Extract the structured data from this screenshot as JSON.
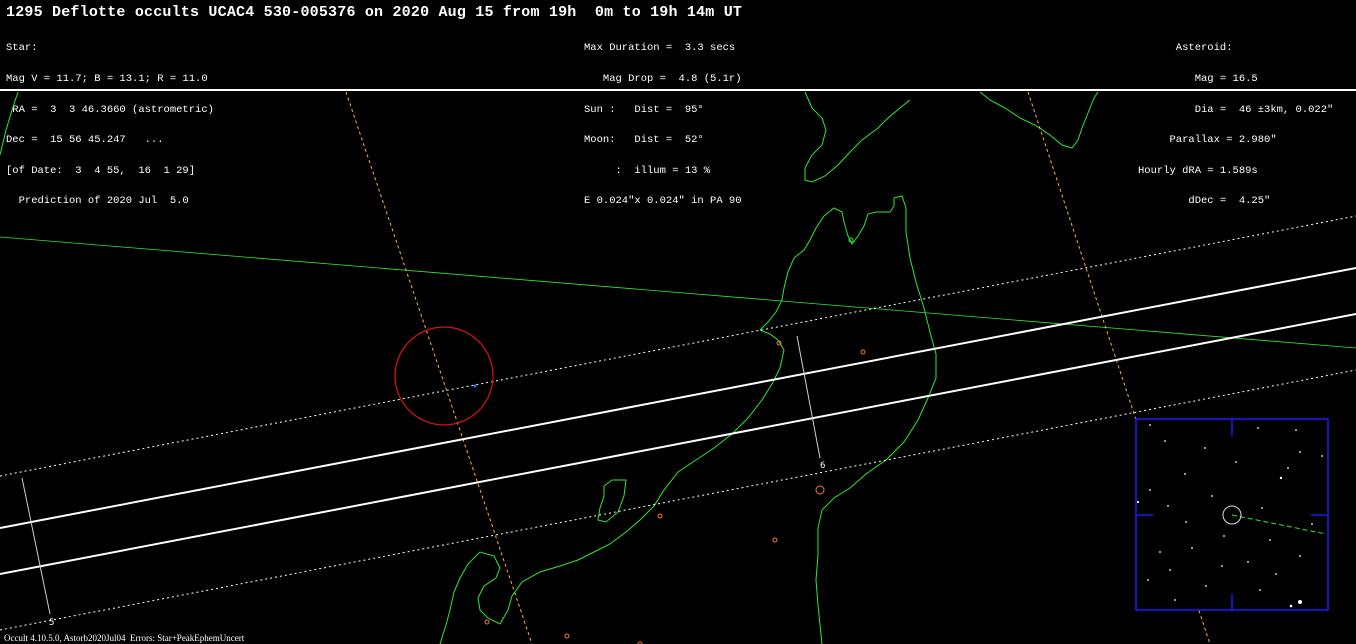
{
  "header": {
    "title": "1295 Deflotte occults UCAC4 530-005376 on 2020 Aug 15 from 19h  0m to 19h 14m UT",
    "star_lines": [
      "Star:",
      "Mag V = 11.7; B = 13.1; R = 11.0",
      " RA =  3  3 46.3660 (astrometric)",
      "Dec =  15 56 45.247   ...",
      "[of Date:  3  4 55,  16  1 29]",
      "  Prediction of 2020 Jul  5.0"
    ],
    "event_lines": [
      "Max Duration =  3.3 secs",
      "   Mag Drop =  4.8 (5.1r)",
      "Sun :   Dist =  95°",
      "Moon:   Dist =  52°",
      "     :  illum = 13 %",
      "E 0.024\"x 0.024\" in PA 90"
    ],
    "asteroid_lines": [
      "      Asteroid:",
      "         Mag = 16.5",
      "         Dia =  46 ±3km, 0.022\"",
      "     Parallax = 2.980\"",
      "Hourly dRA = 1.589s",
      "        dDec =  4.25\""
    ]
  },
  "map": {
    "time_labels": [
      "6",
      "5"
    ],
    "colors": {
      "background": "#000000",
      "coastline": "#2ee82e",
      "path": "#ffffff",
      "sub_star_track": "#ffb040",
      "site_marker": "#ff7a20",
      "circle": "#e01010",
      "finder_border": "#1a1aff"
    }
  },
  "footer": {
    "text": "Occult 4.10.5.0, Astorb2020Jul04  Errors: Star+PeakEphemUncert"
  }
}
